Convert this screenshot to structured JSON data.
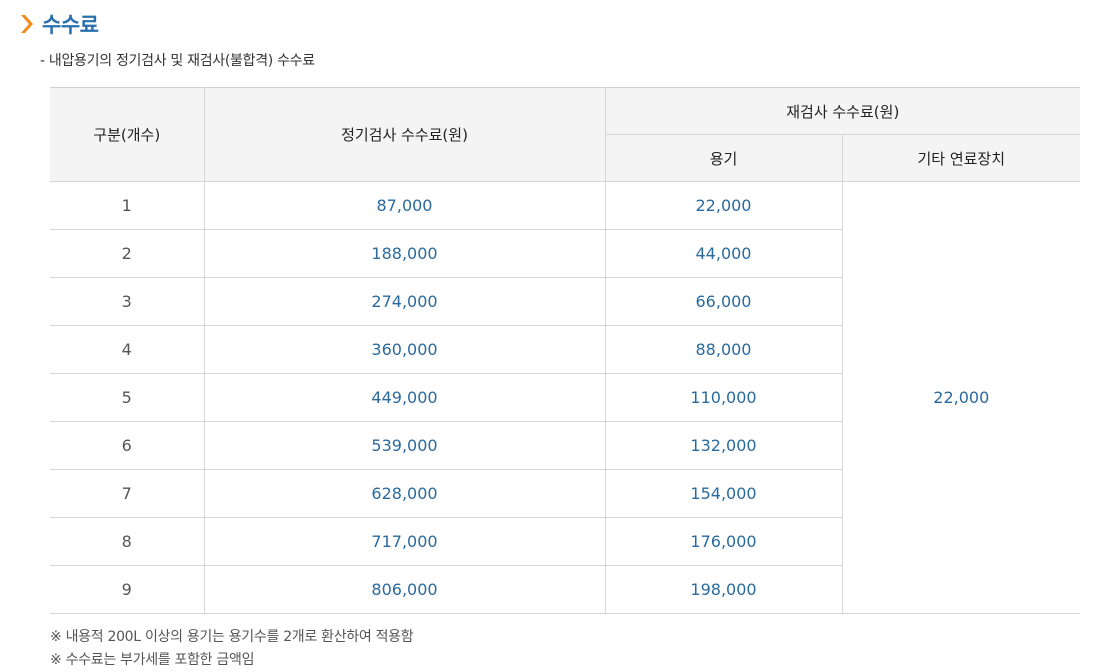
{
  "header": {
    "title": "수수료",
    "subtitle": "- 내압용기의 정기검사 및 재검사(불합격) 수수료",
    "accent_color": "#2a6fae",
    "bullet_color": "#f08a1c",
    "bullet_icon": "chevron-right-icon"
  },
  "table": {
    "col_index": "구분(개수)",
    "col_regular": "정기검사 수수료(원)",
    "col_reinspect": "재검사 수수료(원)",
    "col_vessel": "용기",
    "col_other": "기타 연료장치",
    "other_fee": "22,000",
    "rows": [
      {
        "count": "1",
        "regular": "87,000",
        "vessel": "22,000"
      },
      {
        "count": "2",
        "regular": "188,000",
        "vessel": "44,000"
      },
      {
        "count": "3",
        "regular": "274,000",
        "vessel": "66,000"
      },
      {
        "count": "4",
        "regular": "360,000",
        "vessel": "88,000"
      },
      {
        "count": "5",
        "regular": "449,000",
        "vessel": "110,000"
      },
      {
        "count": "6",
        "regular": "539,000",
        "vessel": "132,000"
      },
      {
        "count": "7",
        "regular": "628,000",
        "vessel": "154,000"
      },
      {
        "count": "8",
        "regular": "717,000",
        "vessel": "176,000"
      },
      {
        "count": "9",
        "regular": "806,000",
        "vessel": "198,000"
      }
    ]
  },
  "notes": [
    "※ 내용적 200L 이상의 용기는 용기수를 2개로 환산하여 적용함",
    "※ 수수료는 부가세를 포함한 금액임"
  ]
}
